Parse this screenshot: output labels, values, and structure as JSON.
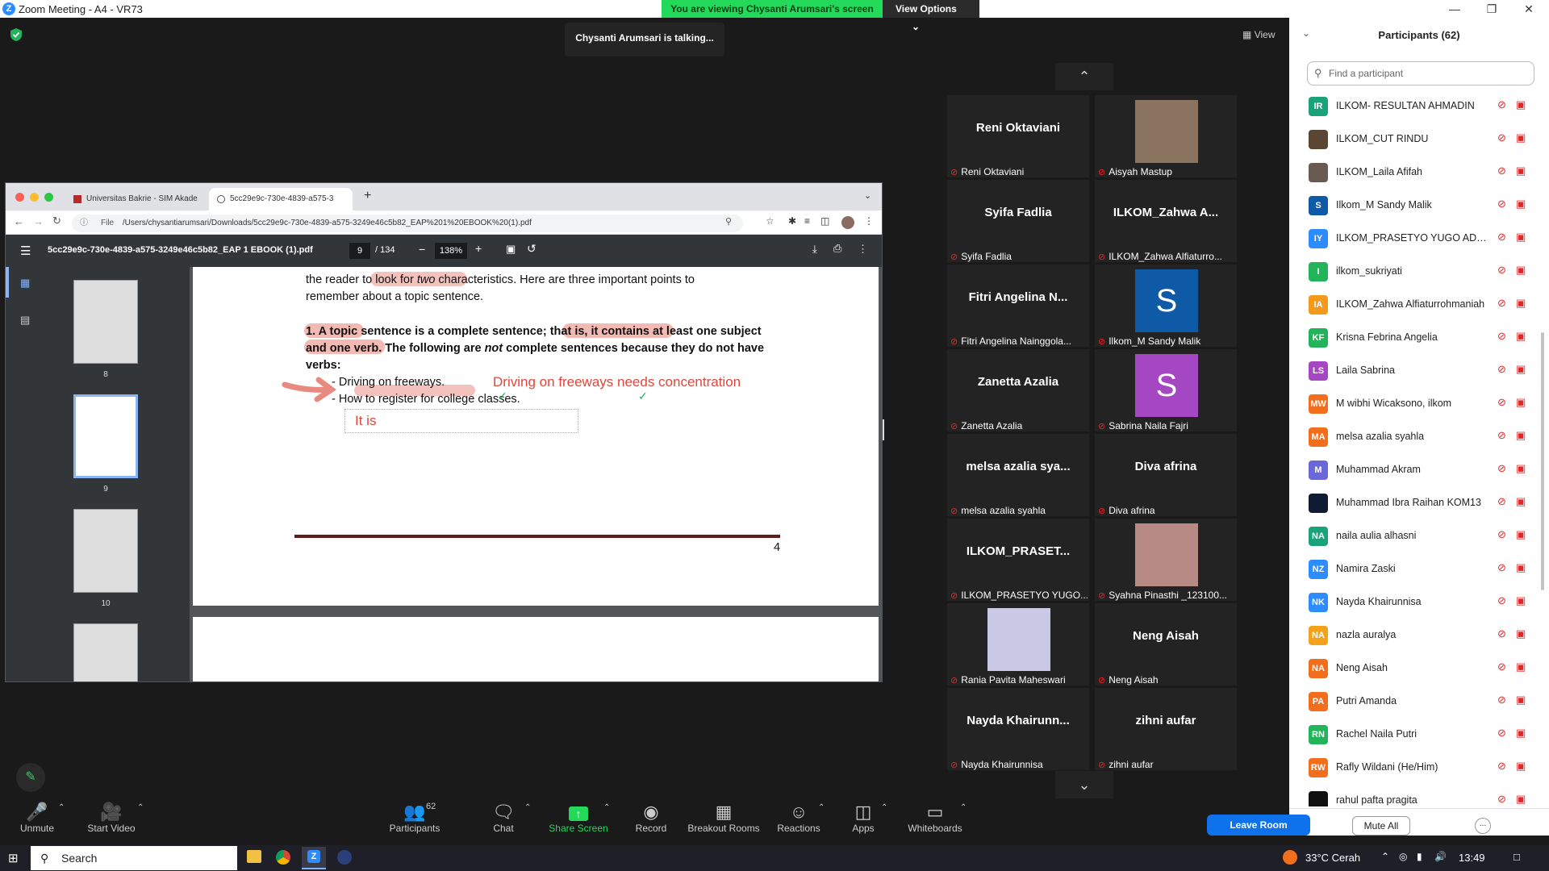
{
  "window": {
    "title": "Zoom Meeting - A4 - VR73",
    "logo": "Z"
  },
  "banner": {
    "text": "You are viewing Chysanti Arumsari's screen",
    "view_options": "View Options"
  },
  "talking": "Chysanti Arumsari is talking...",
  "view_label": "View",
  "browser": {
    "tabs": [
      "Universitas Bakrie - SIM Akade",
      "5cc29e9c-730e-4839-a575-3"
    ],
    "url_prefix": "File",
    "url": "/Users/chysantiarumsari/Downloads/5cc29e9c-730e-4839-a575-3249e46c5b82_EAP%201%20EBOOK%20(1).pdf"
  },
  "pdf": {
    "filename": "5cc29e9c-730e-4839-a575-3249e46c5b82_EAP 1 EBOOK (1).pdf",
    "page": "9",
    "total": "/ 134",
    "zoom": "138%",
    "thumb_labels": [
      "8",
      "9",
      "10"
    ],
    "line1a": "the reader to look for ",
    "line1_two": "two",
    "line1b": " characteristics. Here are three important points to",
    "line2": "remember about a topic sentence.",
    "point1a": "1. A topic sentence is a complete sentence; that is, it contains at least one subject",
    "point1b": "and one verb. The following are ",
    "point1_not": "not",
    "point1c": " complete sentences because they do not have",
    "point1d": "verbs:",
    "bullet1": "- Driving on freeways.",
    "bullet2": "- How to register for college classes.",
    "annotation1": "Driving on freeways needs concentration",
    "annotation2": "It is",
    "page_number": "4"
  },
  "gallery": [
    {
      "title": "Reni Oktaviani",
      "caption": "Reni Oktaviani",
      "kind": "name"
    },
    {
      "title": "",
      "caption": "Aisyah Mastup",
      "kind": "photo",
      "color": "#8a7460"
    },
    {
      "title": "Syifa Fadlia",
      "caption": "Syifa Fadlia",
      "kind": "name"
    },
    {
      "title": "ILKOM_Zahwa A...",
      "caption": "ILKOM_Zahwa Alfiaturro...",
      "kind": "name"
    },
    {
      "title": "Fitri Angelina N...",
      "caption": "Fitri Angelina Nainggola...",
      "kind": "name"
    },
    {
      "title": "S",
      "caption": "Ilkom_M Sandy Malik",
      "kind": "avatar",
      "color": "#0e5aa7"
    },
    {
      "title": "Zanetta Azalia",
      "caption": "Zanetta Azalia",
      "kind": "name"
    },
    {
      "title": "S",
      "caption": "Sabrina Naila Fajri",
      "kind": "avatar",
      "color": "#a546c2"
    },
    {
      "title": "melsa azalia sya...",
      "caption": "melsa azalia syahla",
      "kind": "name"
    },
    {
      "title": "Diva afrina",
      "caption": "Diva afrina",
      "kind": "name"
    },
    {
      "title": "ILKOM_PRASET...",
      "caption": "ILKOM_PRASETYO YUGO...",
      "kind": "name"
    },
    {
      "title": "",
      "caption": "Syahna Pinasthi _123100...",
      "kind": "photo",
      "color": "#b88a84"
    },
    {
      "title": "",
      "caption": "Rania Pavita Maheswari",
      "kind": "photo",
      "color": "#c9c9e6"
    },
    {
      "title": "Neng Aisah",
      "caption": "Neng Aisah",
      "kind": "name"
    },
    {
      "title": "Nayda  Khairunn...",
      "caption": "Nayda Khairunnisa",
      "kind": "name"
    },
    {
      "title": "zihni aufar",
      "caption": "zihni aufar",
      "kind": "name"
    }
  ],
  "participants": {
    "title": "Participants (62)",
    "search_placeholder": "Find a participant",
    "mute_all": "Mute All",
    "more": "...",
    "list": [
      {
        "initials": "IR",
        "name": "ILKOM- RESULTAN AHMADIN",
        "color": "#1aa37a"
      },
      {
        "initials": "",
        "name": "ILKOM_CUT RINDU",
        "color": "#5a4632"
      },
      {
        "initials": "",
        "name": "ILKOM_Laila Afifah",
        "color": "#6b5a52"
      },
      {
        "initials": "S",
        "name": "Ilkom_M Sandy Malik",
        "color": "#0e5aa7"
      },
      {
        "initials": "IY",
        "name": "ILKOM_PRASETYO YUGO ADJIE ...",
        "color": "#2d8cff"
      },
      {
        "initials": "I",
        "name": "ilkom_sukriyati",
        "color": "#23b35a"
      },
      {
        "initials": "IA",
        "name": "ILKOM_Zahwa Alfiaturrohmaniah",
        "color": "#f39a1c"
      },
      {
        "initials": "KF",
        "name": "Krisna Febrina Angelia",
        "color": "#23b35a"
      },
      {
        "initials": "LS",
        "name": "Laila Sabrina",
        "color": "#a546c2"
      },
      {
        "initials": "MW",
        "name": "M wibhi Wicaksono, ilkom",
        "color": "#f36e1c"
      },
      {
        "initials": "MA",
        "name": "melsa azalia syahla",
        "color": "#f36e1c"
      },
      {
        "initials": "M",
        "name": "Muhammad Akram",
        "color": "#6a67d9"
      },
      {
        "initials": "",
        "name": "Muhammad Ibra Raihan KOM13",
        "color": "#0f1a33"
      },
      {
        "initials": "NA",
        "name": "naila aulia alhasni",
        "color": "#1aa37a"
      },
      {
        "initials": "NZ",
        "name": "Namira Zaski",
        "color": "#2d8cff"
      },
      {
        "initials": "NK",
        "name": "Nayda Khairunnisa",
        "color": "#2d8cff"
      },
      {
        "initials": "NA",
        "name": "nazla auralya",
        "color": "#f3a21c"
      },
      {
        "initials": "NA",
        "name": "Neng Aisah",
        "color": "#f36e1c"
      },
      {
        "initials": "PA",
        "name": "Putri Amanda",
        "color": "#f36e1c"
      },
      {
        "initials": "RN",
        "name": "Rachel Naila Putri",
        "color": "#23b35a"
      },
      {
        "initials": "RW",
        "name": "Rafly Wildani (He/Him)",
        "color": "#f36e1c"
      },
      {
        "initials": "",
        "name": "rahul pafta pragita",
        "color": "#111111"
      }
    ]
  },
  "toolbar": {
    "unmute": "Unmute",
    "start_video": "Start Video",
    "participants_count": "62",
    "participants": "Participants",
    "chat": "Chat",
    "share_screen": "Share Screen",
    "record": "Record",
    "breakout": "Breakout Rooms",
    "reactions": "Reactions",
    "apps": "Apps",
    "whiteboards": "Whiteboards",
    "leave": "Leave Room"
  },
  "taskbar": {
    "search": "Search",
    "weather": "33°C  Cerah",
    "time": "13:49"
  },
  "colors": {
    "zoom_blue": "#0e72ed",
    "banner_green": "#23d959",
    "muted_red": "#e02828",
    "annotation_red": "#e0463b"
  }
}
